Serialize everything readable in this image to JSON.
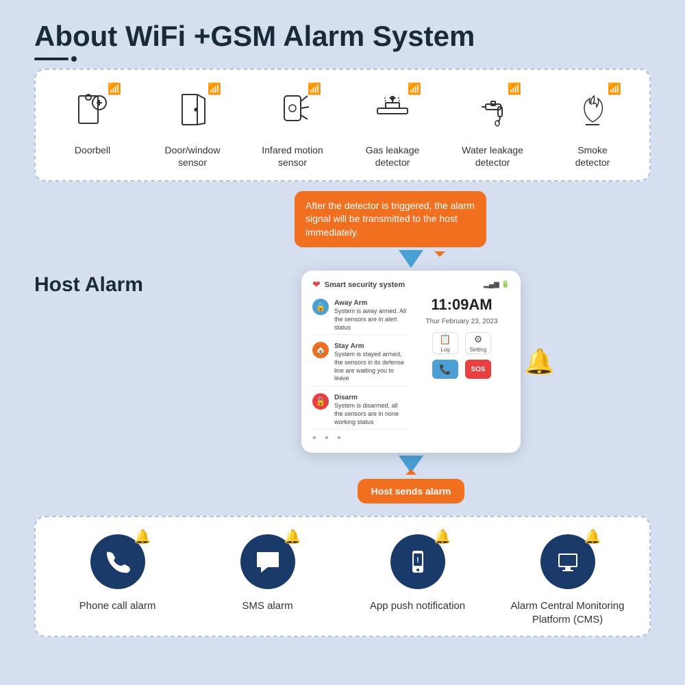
{
  "header": {
    "title": "About WiFi +GSM Alarm System"
  },
  "sensors": [
    {
      "id": "doorbell",
      "label": "Doorbell"
    },
    {
      "id": "door-window",
      "label": "Door/window\nsensor"
    },
    {
      "id": "infrared",
      "label": "Infared motion\nsensor"
    },
    {
      "id": "gas",
      "label": "Gas leakage\ndetector"
    },
    {
      "id": "water",
      "label": "Water leakage\ndetector"
    },
    {
      "id": "smoke",
      "label": "Smoke\ndetector"
    }
  ],
  "speech_bubble": {
    "text": "After the detector is triggered, the alarm signal will be transmitted to the host immediately."
  },
  "host_alarm_label": "Host Alarm",
  "panel": {
    "title": "Smart security system",
    "time": "11:09AM",
    "date": "Thur February 23, 2023",
    "away_arm": "Away Arm",
    "away_arm_desc": "System is away armed. All the sensors are in alert status",
    "stay_arm": "Stay Arm",
    "stay_arm_desc": "System is stayed armed, the sensors in its defense line are waiting you to leave",
    "disarm": "Disarm",
    "disarm_desc": "System is disarmed, all the sensors are in none working status",
    "log_label": "Log",
    "setting_label": "Setting",
    "sos_label": "SOS"
  },
  "host_sends_label": "Host sends alarm",
  "notification_items": [
    {
      "id": "phone",
      "label": "Phone call alarm"
    },
    {
      "id": "sms",
      "label": "SMS alarm"
    },
    {
      "id": "app",
      "label": "App push notification"
    },
    {
      "id": "cms",
      "label": "Alarm Central Monitoring\nPlatform (CMS)"
    }
  ],
  "colors": {
    "accent_blue": "#4a9fd4",
    "accent_orange": "#f07020",
    "accent_red": "#e84040",
    "dark_circle": "#1a3a6a",
    "bg": "#d6dff0"
  }
}
